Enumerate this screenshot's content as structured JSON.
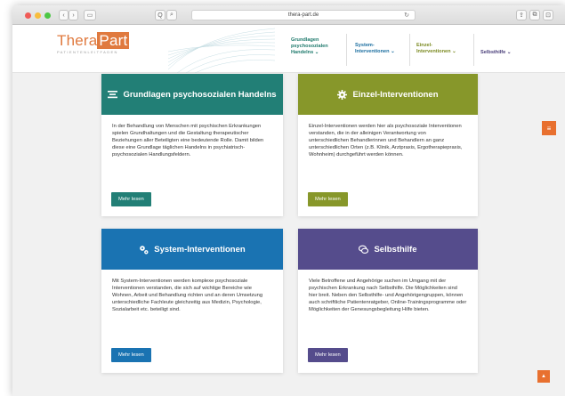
{
  "browser": {
    "url": "thera-part.de",
    "back_glyph": "‹",
    "forward_glyph": "›",
    "sidebar_glyph": "▭",
    "zoom_glyph": "Q",
    "search_glyph": "⌕",
    "reload_glyph": "↻",
    "share_glyph": "⇪",
    "tabs_glyph": "⧉",
    "extra_glyph": "⊡"
  },
  "logo": {
    "thera": "Thera",
    "part": "Part",
    "subtitle": "PATIENTENLEITFADEN"
  },
  "nav": {
    "grundlagen": "Grundlagen psychosozialen Handelns ⌄",
    "system": "System-Interventionen ⌄",
    "einzel": "Einzel-Interventionen ⌄",
    "selbsthilfe": "Selbsthilfe ⌄"
  },
  "cards": {
    "grundlagen": {
      "title": "Grundlagen psychosozialen Handelns",
      "icon": "list-icon",
      "text": "In der Behandlung von Menschen mit psychischen Erkrankungen spielen Grundhaltungen und die Gestaltung therapeutischer Beziehungen aller Beteiligten eine bedeutende Rolle. Damit bilden diese eine Grundlage täglichen Handelns in psychiatrisch-psychosozialen Handlungsfeldern.",
      "button": "Mehr lesen",
      "color": "#227f76"
    },
    "einzel": {
      "title": "Einzel-Interventionen",
      "icon": "gear-icon",
      "text": "Einzel-Interventionen werden hier als psychosoziale Interventionen verstanden, die in der alleinigen Verantwortung von unterschiedlichen Behandlerinnen und Behandlern an ganz unterschiedlichen Orten (z.B. Klinik, Arztpraxis, Ergotherapiepraxis, Wohnheim) durchgeführt werden können.",
      "button": "Mehr lesen",
      "color": "#87972a"
    },
    "system": {
      "title": "System-Interventionen",
      "icon": "gears-icon",
      "text": "Mit System-Interventionen werden komplexe psychosoziale Interventionen verstanden, die sich auf wichtige Bereiche wie Wohnen, Arbeit und Behandlung richten und an deren Umsetzung unterschiedliche Fachleute gleichzeitig aus Medizin, Psychologie, Sozialarbeit etc. beteiligt sind.",
      "button": "Mehr lesen",
      "color": "#1a73b2"
    },
    "selbsthilfe": {
      "title": "Selbsthilfe",
      "icon": "chat-icon",
      "text": "Viele Betroffene und Angehörige suchen im Umgang mit der psychischen Erkrankung nach Selbsthilfe. Die Möglichkeiten sind hier breit. Neben den Selbsthilfe- und Angehörigengruppen, können auch schriftliche Patientenratgeber, Online-Trainingsprogramme oder Möglichkeiten der Genesungsbegleitung Hilfe bieten.",
      "button": "Mehr lesen",
      "color": "#554c8c"
    }
  },
  "floating": {
    "menu_glyph": "≡",
    "top_glyph": "▲"
  }
}
